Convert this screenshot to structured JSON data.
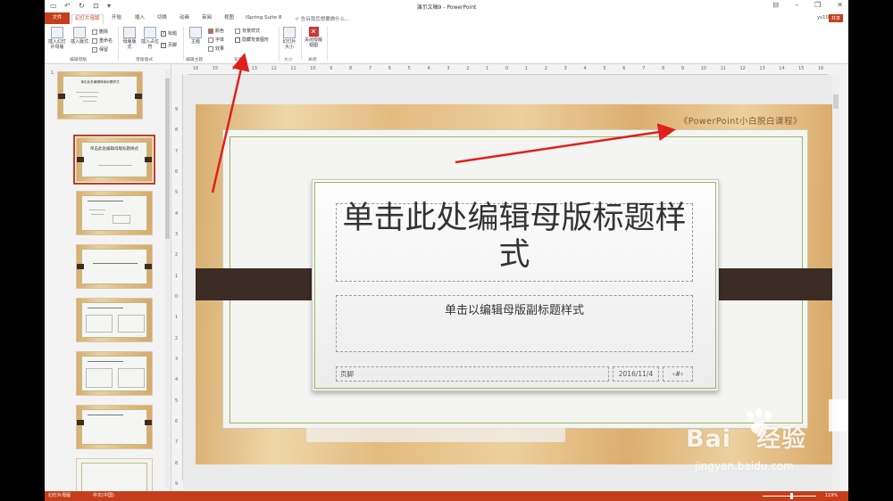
{
  "window": {
    "title": "演示文稿9 - PowerPoint",
    "user": "ys10",
    "share": "共享",
    "tell_me": "告诉我您想要做什么...",
    "tabs": [
      "文件",
      "幻灯片母版",
      "开始",
      "插入",
      "切换",
      "动画",
      "审阅",
      "视图",
      "iSpring Suite 8"
    ]
  },
  "ribbon": {
    "insert_master": "插入幻灯片母版",
    "insert_layout": "插入版式",
    "delete": "删除",
    "rename": "重命名",
    "preserve": "保留",
    "master_layout": "母版版式",
    "insert_placeholder": "插入占位符",
    "title_check": "标题",
    "footer_check": "页脚",
    "themes": "主题",
    "colors": "颜色",
    "fonts": "字体",
    "effects": "效果",
    "background_styles": "背景样式",
    "hide_bg_graphics": "隐藏背景图形",
    "slide_size": "幻灯片大小",
    "close_master_view": "关闭母版视图",
    "groups": {
      "edit_master": "编辑母版",
      "master_layout": "母版版式",
      "edit_theme": "编辑主题",
      "background": "背景",
      "size": "大小",
      "close": "关闭"
    }
  },
  "thumbnails": {
    "first_number": "1",
    "master_title": "单击此处编辑母版标题样式",
    "selected_title": "单击此处编辑母版标题样式"
  },
  "ruler_h": [
    "16",
    "15",
    "14",
    "13",
    "12",
    "11",
    "10",
    "9",
    "8",
    "7",
    "6",
    "5",
    "4",
    "3",
    "2",
    "1",
    "0",
    "1",
    "2",
    "3",
    "4",
    "5",
    "6",
    "7",
    "8",
    "9",
    "10",
    "11",
    "12",
    "13",
    "14",
    "15",
    "16"
  ],
  "ruler_v": [
    "9",
    "8",
    "7",
    "6",
    "5",
    "4",
    "3",
    "2",
    "1",
    "0",
    "1",
    "2",
    "3",
    "4",
    "5",
    "6",
    "7",
    "8",
    "9"
  ],
  "slide": {
    "tagline": "《PowerPoint小白脱白课程》",
    "title": "单击此处编辑母版标题样式",
    "subtitle": "单击以编辑母版副标题样式",
    "footer": "页脚",
    "date": "2016/11/4",
    "page": "‹#›"
  },
  "status": {
    "view": "幻灯片母版",
    "language": "中文(中国)",
    "zoom": "119%"
  },
  "watermark": {
    "brand_a": "Bai",
    "brand_b": "经验",
    "url": "jingyan.baidu.com"
  },
  "colors": {
    "accent": "#c43e1c",
    "arrow": "#e0201c"
  }
}
